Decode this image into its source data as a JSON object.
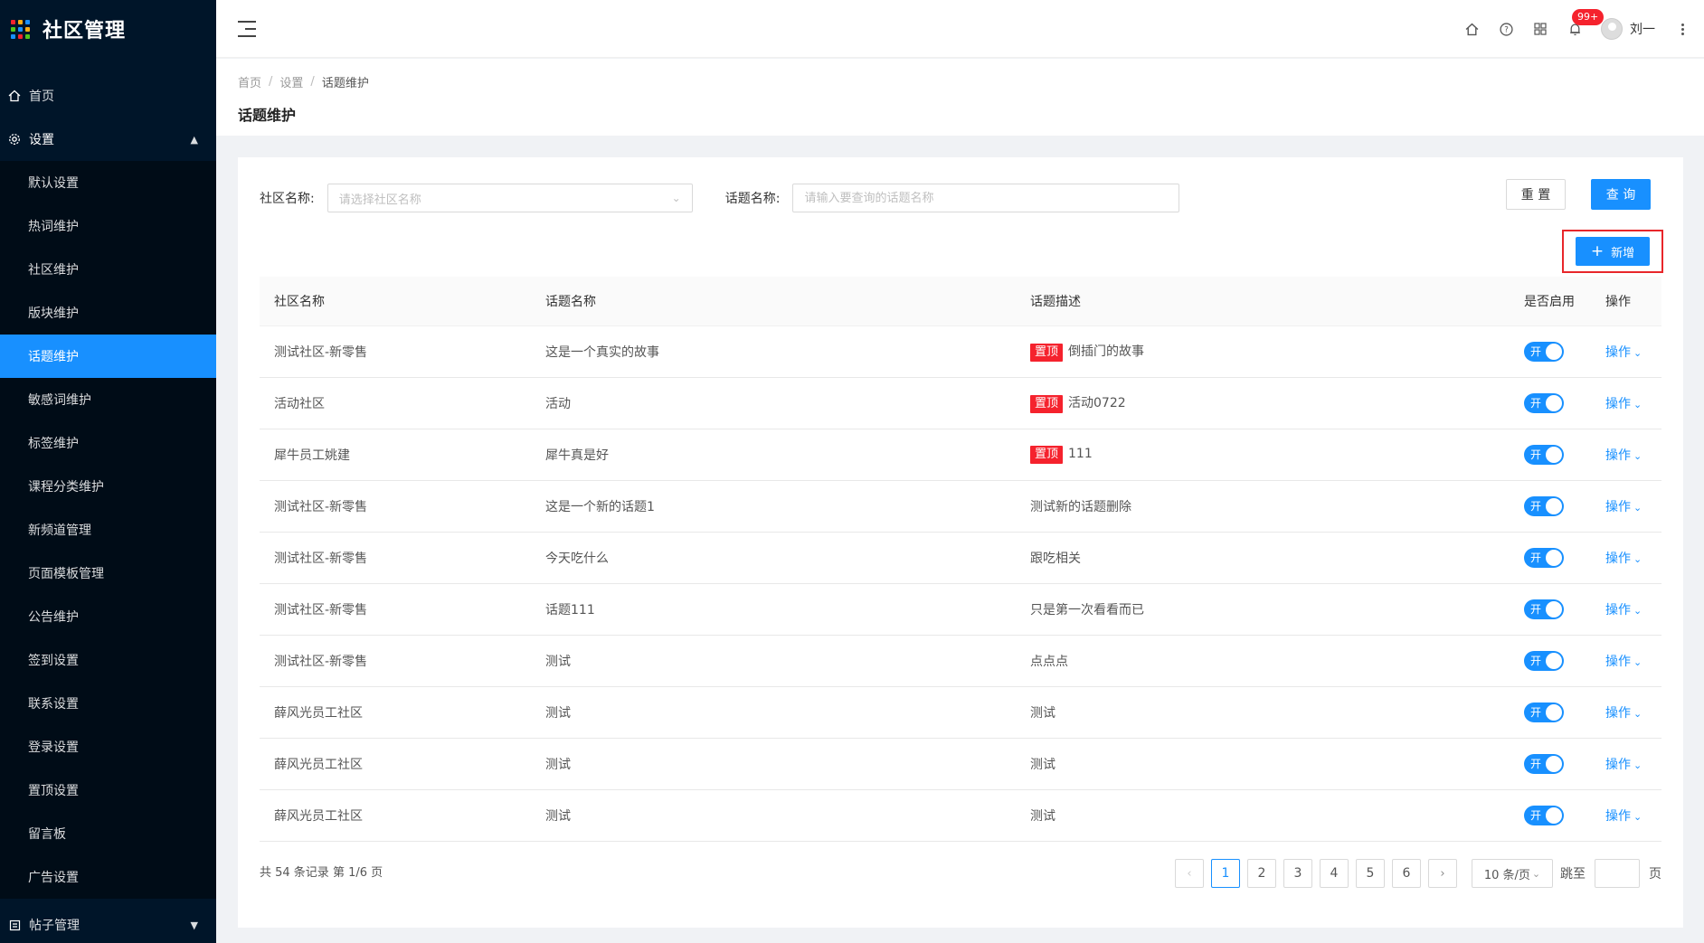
{
  "app": {
    "title": "社区管理",
    "logo_colors": [
      "#f5222d",
      "#faad14",
      "#1890ff",
      "#52c41a",
      "#1890ff",
      "#faad14",
      "#1890ff",
      "#f5222d",
      "#52c41a"
    ]
  },
  "sidebar": {
    "home": {
      "label": "首页",
      "icon": "home-icon"
    },
    "settings": {
      "label": "设置",
      "icon": "gear-icon",
      "items": [
        {
          "label": "默认设置"
        },
        {
          "label": "热词维护"
        },
        {
          "label": "社区维护"
        },
        {
          "label": "版块维护"
        },
        {
          "label": "话题维护",
          "active": true
        },
        {
          "label": "敏感词维护"
        },
        {
          "label": "标签维护"
        },
        {
          "label": "课程分类维护"
        },
        {
          "label": "新频道管理"
        },
        {
          "label": "页面模板管理"
        },
        {
          "label": "公告维护"
        },
        {
          "label": "签到设置"
        },
        {
          "label": "联系设置"
        },
        {
          "label": "登录设置"
        },
        {
          "label": "置顶设置"
        },
        {
          "label": "留言板"
        },
        {
          "label": "广告设置"
        }
      ]
    },
    "posts": {
      "label": "帖子管理",
      "icon": "document-icon"
    }
  },
  "header": {
    "notification_badge": "99+",
    "user_name": "刘一"
  },
  "breadcrumb": [
    "首页",
    "设置",
    "话题维护"
  ],
  "page_title": "话题维护",
  "search": {
    "community_label": "社区名称:",
    "community_placeholder": "请选择社区名称",
    "topic_label": "话题名称:",
    "topic_placeholder": "请输入要查询的话题名称",
    "reset_label": "重 置",
    "query_label": "查 询",
    "add_label": "新增"
  },
  "table": {
    "columns": [
      "社区名称",
      "话题名称",
      "话题描述",
      "是否启用",
      "操作"
    ],
    "switch_label": "开",
    "op_label": "操作",
    "pin_tag": "置顶",
    "rows": [
      {
        "community": "测试社区-新零售",
        "topic": "这是一个真实的故事",
        "pinned": true,
        "desc": "倒插门的故事"
      },
      {
        "community": "活动社区",
        "topic": "活动",
        "pinned": true,
        "desc": "活动0722"
      },
      {
        "community": "犀牛员工姚建",
        "topic": "犀牛真是好",
        "pinned": true,
        "desc": "111"
      },
      {
        "community": "测试社区-新零售",
        "topic": "这是一个新的话题1",
        "pinned": false,
        "desc": "测试新的话题删除"
      },
      {
        "community": "测试社区-新零售",
        "topic": "今天吃什么",
        "pinned": false,
        "desc": "跟吃相关"
      },
      {
        "community": "测试社区-新零售",
        "topic": "话题111",
        "pinned": false,
        "desc": "只是第一次看看而已"
      },
      {
        "community": "测试社区-新零售",
        "topic": "测试",
        "pinned": false,
        "desc": "点点点"
      },
      {
        "community": "薛风光员工社区",
        "topic": "测试",
        "pinned": false,
        "desc": "测试"
      },
      {
        "community": "薛风光员工社区",
        "topic": "测试",
        "pinned": false,
        "desc": "测试"
      },
      {
        "community": "薛风光员工社区",
        "topic": "测试",
        "pinned": false,
        "desc": "测试"
      }
    ]
  },
  "pagination": {
    "total_text": "共 54 条记录 第 1/6 页",
    "pages": [
      "1",
      "2",
      "3",
      "4",
      "5",
      "6"
    ],
    "current": "1",
    "page_size": "10 条/页",
    "jump_label": "跳至",
    "page_unit": "页"
  }
}
